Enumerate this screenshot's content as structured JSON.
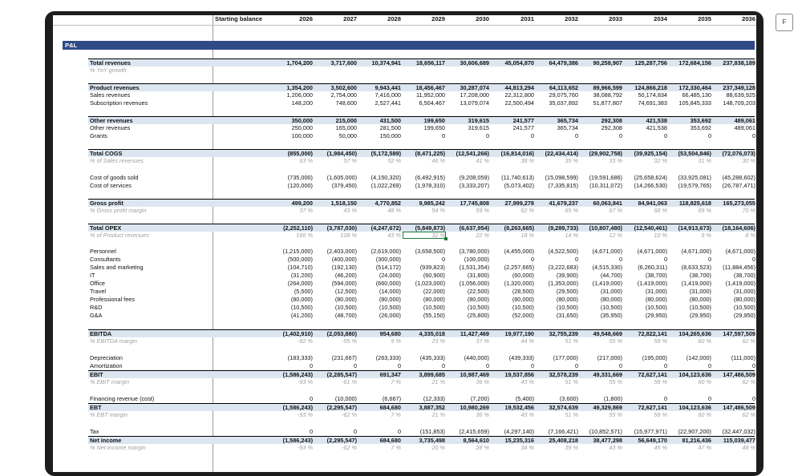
{
  "fullscreen_label": "F",
  "header": {
    "starting_balance": "Starting balance",
    "years": [
      "2026",
      "2027",
      "2028",
      "2029",
      "2030",
      "2031",
      "2032",
      "2033",
      "2034",
      "2035",
      "2036"
    ]
  },
  "section": "P&L",
  "selected_cell": {
    "row": "% of Product revenues",
    "column": "2029",
    "value": "32 %"
  },
  "rows": [
    {
      "label": "Total revenues",
      "style": "bold hl bt",
      "values": [
        "1,704,200",
        "3,717,600",
        "10,374,941",
        "18,656,117",
        "30,606,689",
        "45,054,870",
        "64,479,386",
        "90,258,907",
        "125,287,756",
        "172,684,156",
        "237,838,189"
      ]
    },
    {
      "label": "% YoY growth",
      "style": "pct",
      "values": [
        "",
        "",
        "",
        "",
        "",
        "",
        "",
        "",
        "",
        "",
        ""
      ]
    },
    {
      "label": "Product revenues",
      "style": "bold hl bt",
      "values": [
        "1,354,200",
        "3,502,600",
        "9,943,441",
        "18,456,467",
        "30,287,074",
        "44,813,294",
        "64,113,652",
        "89,966,599",
        "124,866,218",
        "172,330,464",
        "237,349,128"
      ]
    },
    {
      "label": "Sales revenues",
      "style": "",
      "values": [
        "1,206,000",
        "2,754,000",
        "7,416,000",
        "11,952,000",
        "17,208,000",
        "22,312,800",
        "29,075,760",
        "38,088,792",
        "50,174,834",
        "66,485,130",
        "88,639,925"
      ]
    },
    {
      "label": "Subscription revenues",
      "style": "",
      "values": [
        "148,200",
        "748,600",
        "2,527,441",
        "6,504,467",
        "13,079,074",
        "22,500,494",
        "35,037,892",
        "51,877,807",
        "74,691,383",
        "105,845,333",
        "148,709,203"
      ]
    },
    {
      "label": "Other revenues",
      "style": "bold hl bt",
      "values": [
        "350,000",
        "215,000",
        "431,500",
        "199,650",
        "319,615",
        "241,577",
        "365,734",
        "292,308",
        "421,538",
        "353,692",
        "489,061"
      ]
    },
    {
      "label": "Other revenues",
      "style": "",
      "values": [
        "250,000",
        "165,000",
        "281,500",
        "199,650",
        "319,615",
        "241,577",
        "365,734",
        "292,308",
        "421,538",
        "353,692",
        "489,061"
      ]
    },
    {
      "label": "Grants",
      "style": "",
      "values": [
        "100,000",
        "50,000",
        "150,000",
        "0",
        "0",
        "0",
        "0",
        "0",
        "0",
        "0",
        "0"
      ]
    },
    {
      "label": "Total COGS",
      "style": "bold hl bt",
      "values": [
        "(855,000)",
        "(1,984,450)",
        "(5,172,589)",
        "(8,471,225)",
        "(12,541,266)",
        "(16,814,016)",
        "(22,434,414)",
        "(29,902,758)",
        "(39,925,154)",
        "(53,504,846)",
        "(72,076,073)"
      ]
    },
    {
      "label": "% of Sales revenues",
      "style": "pct",
      "values": [
        "63 %",
        "57 %",
        "52 %",
        "46 %",
        "41 %",
        "38 %",
        "35 %",
        "33 %",
        "32 %",
        "31 %",
        "30 %"
      ]
    },
    {
      "label": "Cost of goods sold",
      "style": "",
      "values": [
        "(735,000)",
        "(1,605,000)",
        "(4,150,320)",
        "(6,492,915)",
        "(9,208,059)",
        "(11,740,613)",
        "(15,098,599)",
        "(19,591,686)",
        "(25,658,624)",
        "(33,925,081)",
        "(45,288,602)"
      ]
    },
    {
      "label": "Cost of services",
      "style": "",
      "values": [
        "(120,000)",
        "(379,450)",
        "(1,022,269)",
        "(1,978,310)",
        "(3,333,207)",
        "(5,073,402)",
        "(7,335,815)",
        "(10,311,072)",
        "(14,266,530)",
        "(19,579,765)",
        "(26,787,471)"
      ]
    },
    {
      "label": "Gross profit",
      "style": "bold hl bt",
      "values": [
        "499,200",
        "1,518,150",
        "4,770,852",
        "9,985,242",
        "17,745,808",
        "27,999,278",
        "41,679,237",
        "60,063,841",
        "84,941,063",
        "118,825,618",
        "165,273,055"
      ]
    },
    {
      "label": "% Gross profit margin",
      "style": "pct",
      "values": [
        "37 %",
        "43 %",
        "48 %",
        "54 %",
        "59 %",
        "62 %",
        "65 %",
        "67 %",
        "68 %",
        "69 %",
        "70 %"
      ]
    },
    {
      "label": "Total OPEX",
      "style": "bold hl bt",
      "values": [
        "(2,252,110)",
        "(3,787,030)",
        "(4,247,672)",
        "(5,849,873)",
        "(6,637,954)",
        "(8,263,665)",
        "(9,289,733)",
        "(10,807,480)",
        "(12,540,461)",
        "(14,913,673)",
        "(18,164,606)"
      ]
    },
    {
      "label": "% of Product revenues",
      "style": "pct",
      "values": [
        "166 %",
        "108 %",
        "43 %",
        "32 %",
        "22 %",
        "18 %",
        "14 %",
        "12 %",
        "10 %",
        "9 %",
        "8 %"
      ]
    },
    {
      "label": "Personnel",
      "style": "",
      "values": [
        "(1,215,000)",
        "(2,403,000)",
        "(2,619,000)",
        "(3,658,500)",
        "(3,780,000)",
        "(4,455,000)",
        "(4,522,500)",
        "(4,671,000)",
        "(4,671,000)",
        "(4,671,000)",
        "(4,671,000)"
      ]
    },
    {
      "label": "Consultants",
      "style": "",
      "values": [
        "(500,000)",
        "(400,000)",
        "(300,000)",
        "0",
        "(100,000)",
        "0",
        "0",
        "0",
        "0",
        "0",
        "0"
      ]
    },
    {
      "label": "Sales and marketing",
      "style": "",
      "values": [
        "(104,710)",
        "(192,130)",
        "(514,172)",
        "(939,823)",
        "(1,531,354)",
        "(2,257,665)",
        "(3,222,683)",
        "(4,515,330)",
        "(6,260,311)",
        "(8,633,523)",
        "(11,884,456)"
      ]
    },
    {
      "label": "IT",
      "style": "",
      "values": [
        "(31,200)",
        "(46,200)",
        "(24,000)",
        "(60,900)",
        "(31,800)",
        "(60,000)",
        "(39,900)",
        "(44,700)",
        "(38,700)",
        "(38,700)",
        "(38,700)"
      ]
    },
    {
      "label": "Office",
      "style": "",
      "values": [
        "(264,000)",
        "(594,000)",
        "(660,000)",
        "(1,023,000)",
        "(1,056,000)",
        "(1,320,000)",
        "(1,353,000)",
        "(1,419,000)",
        "(1,419,000)",
        "(1,419,000)",
        "(1,419,000)"
      ]
    },
    {
      "label": "Travel",
      "style": "",
      "values": [
        "(5,500)",
        "(12,500)",
        "(14,000)",
        "(22,000)",
        "(22,500)",
        "(28,500)",
        "(29,500)",
        "(31,000)",
        "(31,000)",
        "(31,000)",
        "(31,000)"
      ]
    },
    {
      "label": "Professional fees",
      "style": "",
      "values": [
        "(80,000)",
        "(80,000)",
        "(80,000)",
        "(80,000)",
        "(80,000)",
        "(80,000)",
        "(80,000)",
        "(80,000)",
        "(80,000)",
        "(80,000)",
        "(80,000)"
      ]
    },
    {
      "label": "R&D",
      "style": "",
      "values": [
        "(10,500)",
        "(10,500)",
        "(10,500)",
        "(10,500)",
        "(10,500)",
        "(10,500)",
        "(10,500)",
        "(10,500)",
        "(10,500)",
        "(10,500)",
        "(10,500)"
      ]
    },
    {
      "label": "G&A",
      "style": "",
      "values": [
        "(41,200)",
        "(48,700)",
        "(26,000)",
        "(55,150)",
        "(25,800)",
        "(52,000)",
        "(31,650)",
        "(35,950)",
        "(29,950)",
        "(29,950)",
        "(29,950)"
      ]
    },
    {
      "label": "EBITDA",
      "style": "bold hl bt",
      "values": [
        "(1,402,910)",
        "(2,053,880)",
        "954,680",
        "4,335,018",
        "11,427,469",
        "19,977,190",
        "32,755,239",
        "49,548,669",
        "72,822,141",
        "104,265,636",
        "147,597,509"
      ]
    },
    {
      "label": "% EBITDA margin",
      "style": "pct",
      "values": [
        "-82 %",
        "-55 %",
        "9 %",
        "23 %",
        "37 %",
        "44 %",
        "51 %",
        "55 %",
        "58 %",
        "60 %",
        "62 %"
      ]
    },
    {
      "label": "Depreciation",
      "style": "",
      "values": [
        "(183,333)",
        "(231,667)",
        "(263,333)",
        "(435,333)",
        "(440,000)",
        "(439,333)",
        "(177,000)",
        "(217,000)",
        "(195,000)",
        "(142,000)",
        "(111,000)"
      ]
    },
    {
      "label": "Amortization",
      "style": "",
      "values": [
        "0",
        "0",
        "0",
        "0",
        "0",
        "0",
        "0",
        "0",
        "0",
        "0",
        "0"
      ]
    },
    {
      "label": "EBIT",
      "style": "bold hl bt",
      "values": [
        "(1,586,243)",
        "(2,285,547)",
        "691,347",
        "3,899,685",
        "10,987,469",
        "19,537,856",
        "32,578,239",
        "49,331,669",
        "72,627,141",
        "104,123,636",
        "147,486,509"
      ]
    },
    {
      "label": "% EBIT margin",
      "style": "pct",
      "values": [
        "-93 %",
        "-61 %",
        "7 %",
        "21 %",
        "36 %",
        "43 %",
        "51 %",
        "55 %",
        "58 %",
        "60 %",
        "62 %"
      ]
    },
    {
      "label": "Financing revenue (cost)",
      "style": "",
      "values": [
        "0",
        "(10,000)",
        "(6,667)",
        "(12,333)",
        "(7,200)",
        "(5,400)",
        "(3,600)",
        "(1,800)",
        "0",
        "0",
        "0"
      ]
    },
    {
      "label": "EBT",
      "style": "bold hl bt",
      "values": [
        "(1,586,243)",
        "(2,295,547)",
        "684,680",
        "3,887,352",
        "10,980,269",
        "19,532,456",
        "32,574,639",
        "49,329,869",
        "72,627,141",
        "104,123,636",
        "147,486,509"
      ]
    },
    {
      "label": "% EBT margin",
      "style": "pct",
      "values": [
        "-93 %",
        "-62 %",
        "7 %",
        "21 %",
        "36 %",
        "43 %",
        "51 %",
        "55 %",
        "58 %",
        "60 %",
        "62 %"
      ]
    },
    {
      "label": "Tax",
      "style": "",
      "values": [
        "0",
        "0",
        "0",
        "(151,853)",
        "(2,415,659)",
        "(4,297,140)",
        "(7,166,421)",
        "(10,852,571)",
        "(15,977,971)",
        "(22,907,200)",
        "(32,447,032)"
      ]
    },
    {
      "label": "Net income",
      "style": "bold hl bt",
      "values": [
        "(1,586,243)",
        "(2,295,547)",
        "684,680",
        "3,735,498",
        "8,564,610",
        "15,235,316",
        "25,408,218",
        "38,477,298",
        "56,649,170",
        "81,216,436",
        "115,039,477"
      ]
    },
    {
      "label": "% Net income margin",
      "style": "pct",
      "values": [
        "-93 %",
        "-62 %",
        "7 %",
        "20 %",
        "28 %",
        "34 %",
        "39 %",
        "43 %",
        "45 %",
        "47 %",
        "48 %"
      ]
    }
  ]
}
